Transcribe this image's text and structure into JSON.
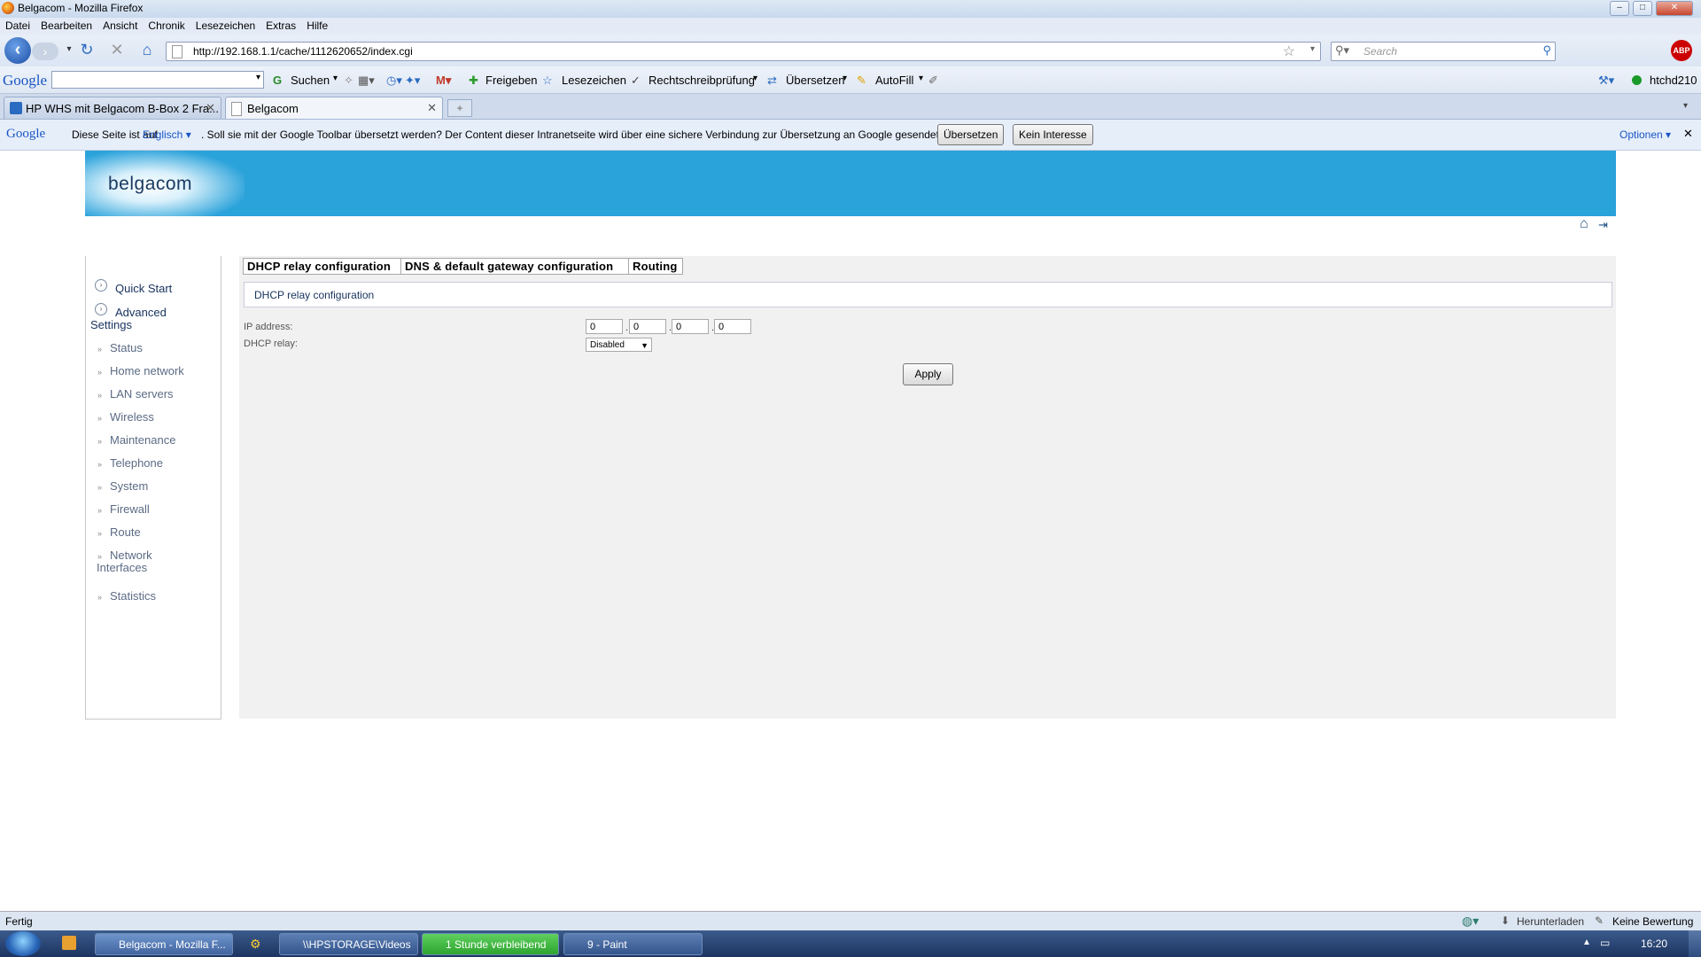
{
  "window": {
    "title": "Belgacom - Mozilla Firefox"
  },
  "menu": [
    "Datei",
    "Bearbeiten",
    "Ansicht",
    "Chronik",
    "Lesezeichen",
    "Extras",
    "Hilfe"
  ],
  "nav": {
    "url": "http://192.168.1.1/cache/1112620652/index.cgi",
    "search_placeholder": "Search",
    "abp_label": "ABP"
  },
  "google_toolbar": {
    "logo": "Google",
    "search_value": "",
    "items": {
      "suchen": "Suchen",
      "freigeben": "Freigeben",
      "lesezeichen": "Lesezeichen",
      "rechtschreibung": "Rechtschreibprüfung",
      "uebersetzen": "Übersetzen",
      "autofill": "AutoFill",
      "user": "htchd210"
    }
  },
  "tabs": [
    {
      "label": "HP WHS mit Belgacom B-Box 2 Fra...",
      "active": false
    },
    {
      "label": "Belgacom",
      "active": true
    }
  ],
  "translate_bar": {
    "logo": "Google",
    "prefix": "Diese Seite ist auf",
    "language": "Englisch",
    "message": ". Soll sie mit der Google Toolbar übersetzt werden? Der Content dieser Intranetseite wird über eine sichere Verbindung zur Übersetzung an Google gesendet.",
    "translate_button": "Übersetzen",
    "dismiss_button": "Kein Interesse",
    "options": "Optionen"
  },
  "page": {
    "logo": "belgacom",
    "sidebar": {
      "quick_start": "Quick Start",
      "advanced_line1": "Advanced",
      "advanced_line2": "Settings",
      "items": [
        "Status",
        "Home network",
        "LAN servers",
        "Wireless",
        "Maintenance",
        "Telephone",
        "System",
        "Firewall",
        "Route"
      ],
      "network_line1": "Network",
      "network_line2": "Interfaces",
      "statistics": "Statistics"
    },
    "subtabs": [
      "DHCP relay configuration",
      "DNS & default gateway configuration",
      "Routing"
    ],
    "section_title": "DHCP relay configuration",
    "form": {
      "ip_label": "IP address:",
      "ip": [
        "0",
        "0",
        "0",
        "0"
      ],
      "relay_label": "DHCP relay:",
      "relay_value": "Disabled",
      "apply": "Apply"
    }
  },
  "statusbar": {
    "left": "Fertig",
    "download": "Herunterladen",
    "rating": "Keine Bewertung"
  },
  "taskbar": {
    "buttons": [
      "Belgacom - Mozilla F...",
      "\\\\HPSTORAGE\\Videos",
      "1 Stunde verbleibend",
      "9 - Paint"
    ],
    "clock": "16:20"
  }
}
